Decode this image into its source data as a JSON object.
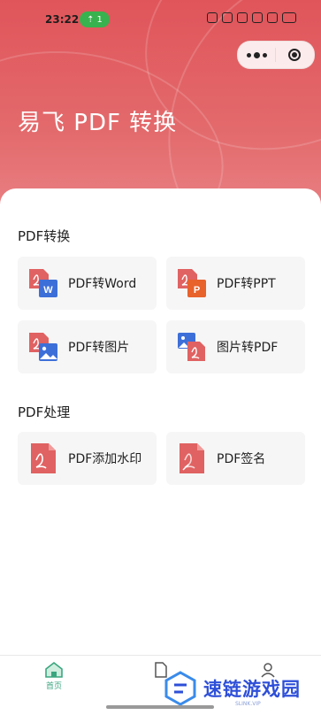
{
  "status_bar": {
    "time": "23:22",
    "indicator_count": "1"
  },
  "header": {
    "title": "易飞 PDF 转换"
  },
  "sections": [
    {
      "title": "PDF转换",
      "items": [
        {
          "label": "PDF转Word",
          "icon": "pdf-to-word-icon"
        },
        {
          "label": "PDF转PPT",
          "icon": "pdf-to-ppt-icon"
        },
        {
          "label": "PDF转图片",
          "icon": "pdf-to-image-icon"
        },
        {
          "label": "图片转PDF",
          "icon": "image-to-pdf-icon"
        }
      ]
    },
    {
      "title": "PDF处理",
      "items": [
        {
          "label": "PDF添加水印",
          "icon": "pdf-watermark-icon"
        },
        {
          "label": "PDF签名",
          "icon": "pdf-sign-icon"
        }
      ]
    }
  ],
  "tabbar": {
    "tabs": [
      {
        "label": "首页",
        "icon": "home-icon",
        "active": true
      },
      {
        "label": "",
        "icon": "document-icon"
      },
      {
        "label": "",
        "icon": "user-icon"
      }
    ]
  },
  "watermark": {
    "text": "速链游戏园",
    "url": "SLINK.VIP"
  },
  "colors": {
    "accent": "#e0555a",
    "pdf_red": "#e06262",
    "word_blue": "#3d6fd9",
    "ppt_orange": "#e8622b",
    "tab_active": "#3aa67f"
  }
}
